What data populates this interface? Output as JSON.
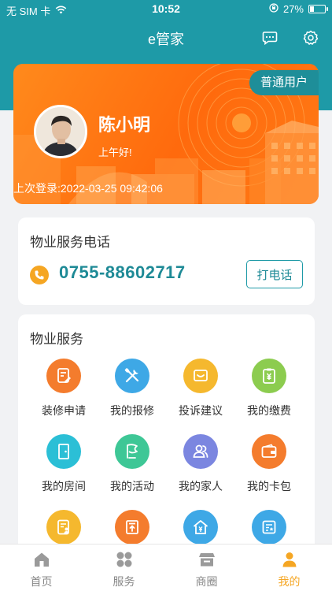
{
  "status_bar": {
    "carrier": "无 SIM 卡",
    "time": "10:52",
    "battery_percent": "27%",
    "battery_level": 0.27,
    "icons": [
      "wifi-icon",
      "rotation-lock-icon",
      "battery-icon"
    ]
  },
  "navbar": {
    "title": "e管家",
    "icons": [
      "message-icon",
      "settings-gear-icon"
    ]
  },
  "user_card": {
    "role_badge": "普通用户",
    "name": "陈小明",
    "greeting": "上午好!",
    "last_login": "上次登录:2022-03-25 09:42:06"
  },
  "phone_section": {
    "title": "物业服务电话",
    "phone_number": "0755-88602717",
    "call_button": "打电话"
  },
  "services_section": {
    "title": "物业服务",
    "items": [
      {
        "label": "装修申请",
        "icon": "renovation-form-icon",
        "color": "#f47c2d"
      },
      {
        "label": "我的报修",
        "icon": "repair-tools-icon",
        "color": "#3ea8e6"
      },
      {
        "label": "投诉建议",
        "icon": "complaint-message-icon",
        "color": "#f5b82e"
      },
      {
        "label": "我的缴费",
        "icon": "payment-bill-icon",
        "color": "#8ccc4f"
      },
      {
        "label": "我的房间",
        "icon": "room-door-icon",
        "color": "#2bbfd6"
      },
      {
        "label": "我的活动",
        "icon": "activity-flag-icon",
        "color": "#3ec796"
      },
      {
        "label": "我的家人",
        "icon": "family-people-icon",
        "color": "#7b86e0"
      },
      {
        "label": "我的卡包",
        "icon": "card-wallet-icon",
        "color": "#f47c2d"
      },
      {
        "label": "",
        "icon": "document-person-icon",
        "color": "#f5b82e"
      },
      {
        "label": "",
        "icon": "upload-box-icon",
        "color": "#f47c2d"
      },
      {
        "label": "",
        "icon": "house-yen-icon",
        "color": "#3ea8e6"
      },
      {
        "label": "",
        "icon": "list-star-icon",
        "color": "#3ea8e6"
      }
    ]
  },
  "tab_bar": {
    "tabs": [
      {
        "label": "首页",
        "icon": "home-icon",
        "active": false
      },
      {
        "label": "服务",
        "icon": "services-grid-icon",
        "active": false
      },
      {
        "label": "商圈",
        "icon": "store-icon",
        "active": false
      },
      {
        "label": "我的",
        "icon": "profile-person-icon",
        "active": true
      }
    ]
  },
  "colors": {
    "primary": "#1e9aa7",
    "accent": "#f5a623",
    "card_orange": "#ff7a16"
  }
}
